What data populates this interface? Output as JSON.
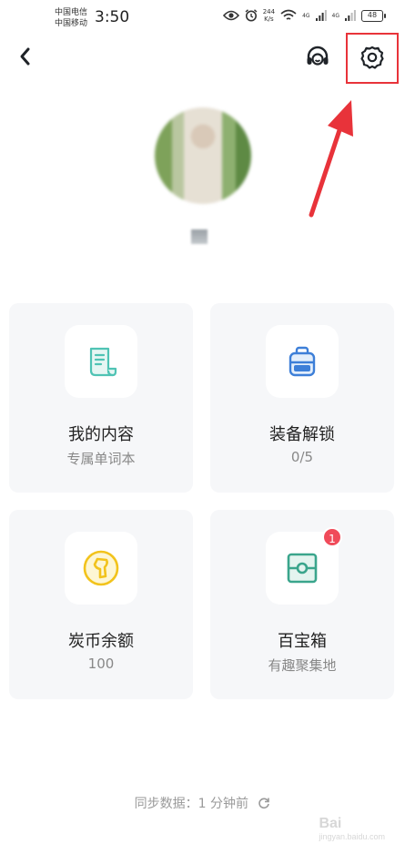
{
  "status_bar": {
    "carrier_1": "中国电信",
    "carrier_2": "中国移动",
    "time": "3:50",
    "net_speed_value": "244",
    "net_speed_unit": "K/s",
    "signal_1": "4G",
    "signal_2": "4G",
    "battery": "48"
  },
  "nav": {
    "back_icon": "chevron-left-icon",
    "service_icon": "headset-icon",
    "settings_icon": "gear-icon"
  },
  "cards": [
    {
      "title": "我的内容",
      "subtitle": "专属单词本",
      "icon": "scroll-icon",
      "icon_color": "#4fc3b4"
    },
    {
      "title": "装备解锁",
      "subtitle": "0/5",
      "icon": "backpack-icon",
      "icon_color": "#3d7fd8"
    },
    {
      "title": "炭币余额",
      "subtitle": "100",
      "icon": "coin-icon",
      "icon_color": "#f2c31c"
    },
    {
      "title": "百宝箱",
      "subtitle": "有趣聚集地",
      "icon": "treasure-box-icon",
      "icon_color": "#3aa58c",
      "badge": "1"
    }
  ],
  "sync": {
    "label": "同步数据：",
    "time": "1 分钟前"
  },
  "watermark": {
    "brand": "Bai",
    "site": "jingyan.baidu.com"
  },
  "annotation_color": "#e8333a"
}
